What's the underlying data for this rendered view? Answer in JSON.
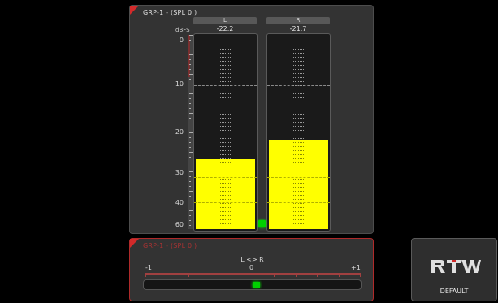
{
  "level_meter": {
    "title": "GRP-1 - (SPL 0 )",
    "unit": "dBFS",
    "scale": [
      "0",
      "10",
      "20",
      "30",
      "40",
      "60"
    ],
    "channels": [
      {
        "name": "L",
        "peak": "-22.2",
        "level_fraction": 0.36
      },
      {
        "name": "R",
        "peak": "-21.7",
        "level_fraction": 0.46
      }
    ],
    "sync_indicator_color": "#00d000"
  },
  "correlation_meter": {
    "title": "GRP-1 - (SPL 0 )",
    "caption": "L <> R",
    "scale": [
      "-1",
      "0",
      "+1"
    ],
    "value": 0.03,
    "accent_color": "#d22a2a"
  },
  "preset_button": {
    "logo": "RTW",
    "label": "DEFAULT"
  },
  "colors": {
    "bar": "#ffff00",
    "accent": "#d22a2a",
    "panel": "#333333"
  }
}
